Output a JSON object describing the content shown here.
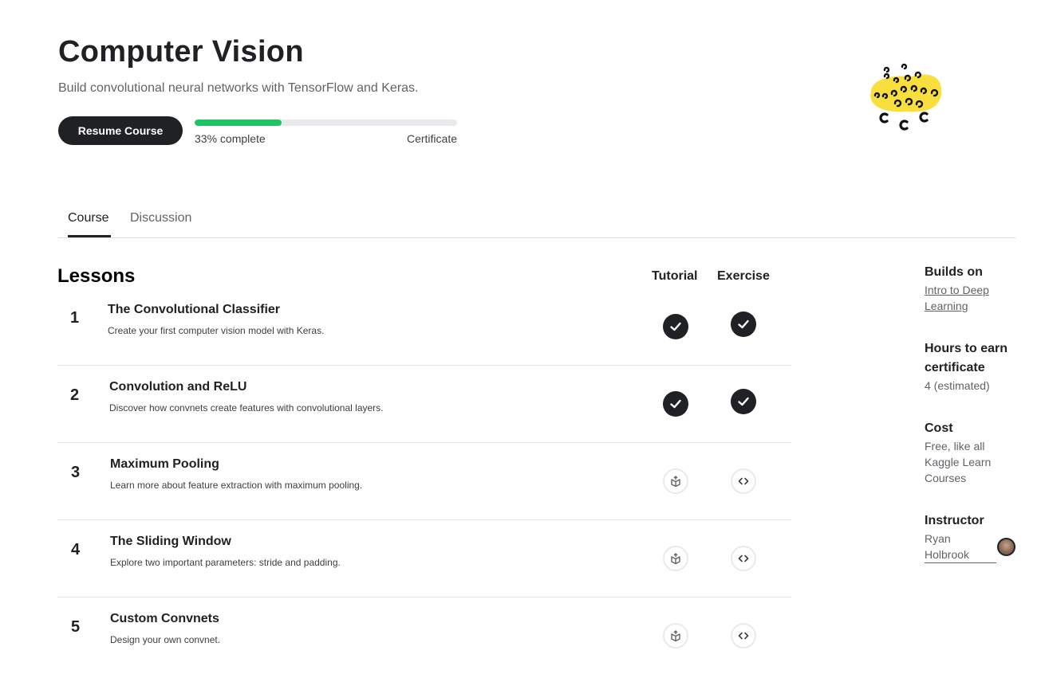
{
  "course": {
    "title": "Computer Vision",
    "subtitle": "Build convolutional neural networks with TensorFlow and Keras.",
    "resume_label": "Resume Course",
    "progress_text": "33% complete",
    "progress_fraction": 0.33,
    "certificate_label": "Certificate"
  },
  "tabs": [
    {
      "label": "Course",
      "active": true
    },
    {
      "label": "Discussion",
      "active": false
    }
  ],
  "lessons_section": {
    "heading": "Lessons",
    "tutorial_col": "Tutorial",
    "exercise_col": "Exercise"
  },
  "lessons": [
    {
      "num": "1",
      "title": "The Convolutional Classifier",
      "desc": "Create your first computer vision model with Keras.",
      "tutorial_done": true,
      "exercise_done": true
    },
    {
      "num": "2",
      "title": "Convolution and ReLU",
      "desc": "Discover how convnets create features with convolutional layers.",
      "tutorial_done": true,
      "exercise_done": true
    },
    {
      "num": "3",
      "title": "Maximum Pooling",
      "desc": "Learn more about feature extraction with maximum pooling.",
      "tutorial_done": false,
      "exercise_done": false
    },
    {
      "num": "4",
      "title": "The Sliding Window",
      "desc": "Explore two important parameters: stride and padding.",
      "tutorial_done": false,
      "exercise_done": false
    },
    {
      "num": "5",
      "title": "Custom Convnets",
      "desc": "Design your own convnet.",
      "tutorial_done": false,
      "exercise_done": false
    }
  ],
  "sidebar": {
    "builds_on_heading": "Builds on",
    "builds_on_line1": "Intro to Deep",
    "builds_on_line2": "Learning",
    "hours_heading_line1": "Hours to earn",
    "hours_heading_line2": "certificate",
    "hours_value": "4 (estimated)",
    "cost_heading": "Cost",
    "cost_line1": "Free, like all",
    "cost_line2": "Kaggle Learn",
    "cost_line3": "Courses",
    "instructor_heading": "Instructor",
    "instructor_line1": "Ryan",
    "instructor_line2": "Holbrook"
  },
  "colors": {
    "accent_green": "#20c465",
    "dark": "#202124",
    "logo_yellow": "#f9df3d"
  }
}
